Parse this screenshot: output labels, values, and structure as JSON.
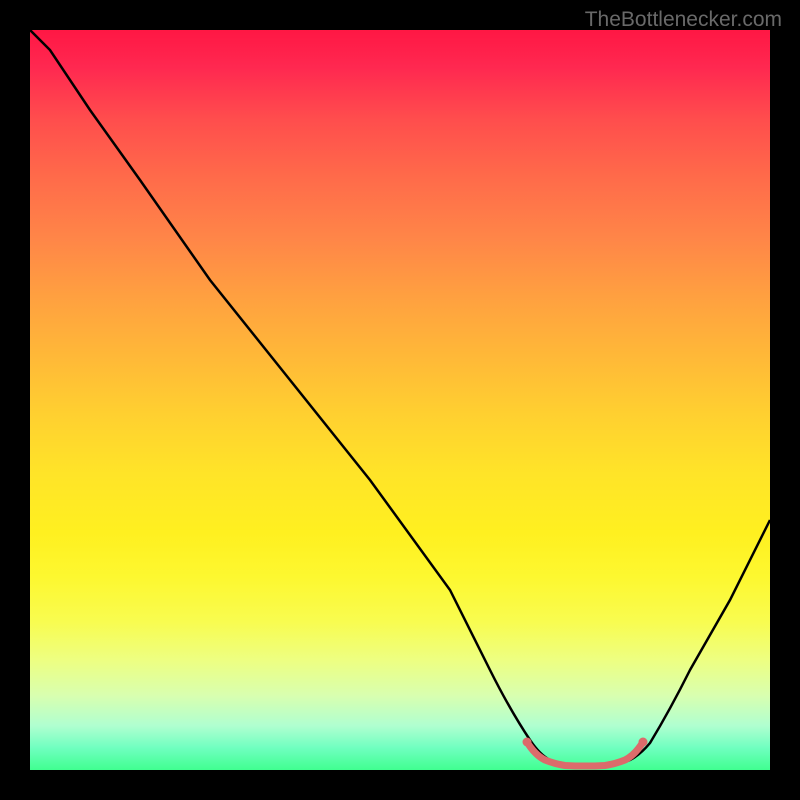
{
  "watermark": "TheBottlenecker.com",
  "chart_data": {
    "type": "line",
    "title": "",
    "xlabel": "",
    "ylabel": "",
    "xlim": [
      0,
      100
    ],
    "ylim": [
      0,
      100
    ],
    "series": [
      {
        "name": "bottleneck-curve",
        "x": [
          0,
          6,
          15,
          25,
          35,
          45,
          55,
          62,
          65,
          68,
          70,
          72,
          74,
          76,
          78,
          80,
          82,
          85,
          90,
          95,
          100
        ],
        "y": [
          100,
          94,
          82,
          68,
          55,
          41,
          27,
          16,
          10,
          5,
          2.5,
          1.5,
          1,
          1,
          1,
          1.5,
          2.5,
          5,
          12,
          22,
          34
        ]
      }
    ],
    "annotations": [
      {
        "type": "highlight-region",
        "x_start": 68,
        "x_end": 82,
        "color": "#e57373",
        "description": "optimal-range-marker"
      }
    ],
    "gradient_stops": [
      {
        "pos": 0,
        "color": "#ff1744"
      },
      {
        "pos": 50,
        "color": "#ffd030"
      },
      {
        "pos": 80,
        "color": "#f8fc50"
      },
      {
        "pos": 100,
        "color": "#40ff90"
      }
    ]
  }
}
